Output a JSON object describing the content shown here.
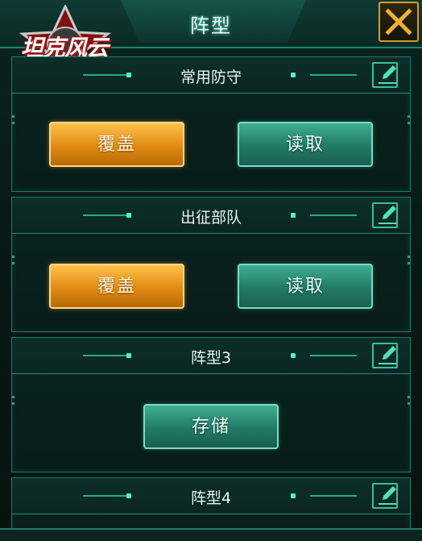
{
  "header": {
    "title": "阵型"
  },
  "logo": {
    "text": "坦克风云"
  },
  "panels": [
    {
      "title": "常用防守",
      "buttons": [
        {
          "label": "覆盖"
        },
        {
          "label": "读取"
        }
      ]
    },
    {
      "title": "出征部队",
      "buttons": [
        {
          "label": "覆盖"
        },
        {
          "label": "读取"
        }
      ]
    },
    {
      "title": "阵型3",
      "buttons": [
        {
          "label": "存储"
        }
      ]
    },
    {
      "title": "阵型4",
      "buttons": []
    }
  ],
  "icons": {
    "close": "close-icon",
    "edit": "edit-icon"
  },
  "colors": {
    "accent": "#2cd7ae",
    "gold": "#e08b12",
    "green": "#217a66",
    "close_border": "#d99a26"
  }
}
